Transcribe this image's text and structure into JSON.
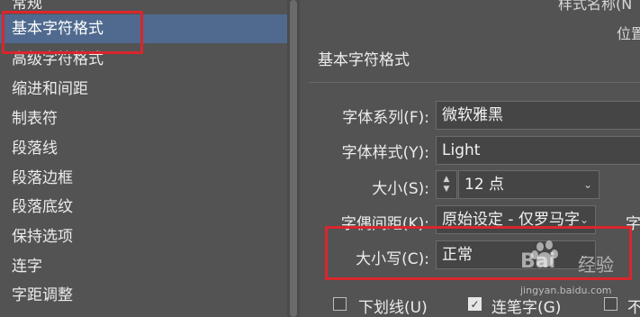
{
  "sidebar": {
    "items": [
      {
        "label": "常规"
      },
      {
        "label": "基本字符格式"
      },
      {
        "label": "高级字符格式"
      },
      {
        "label": "缩进和间距"
      },
      {
        "label": "制表符"
      },
      {
        "label": "段落线"
      },
      {
        "label": "段落边框"
      },
      {
        "label": "段落底纹"
      },
      {
        "label": "保持选项"
      },
      {
        "label": "连字"
      },
      {
        "label": "字距调整"
      }
    ],
    "selected_index": 1
  },
  "header": {
    "style_name_label": "样式名称(N",
    "position_label": "位置"
  },
  "section": {
    "title": "基本字符格式"
  },
  "form": {
    "font_family": {
      "label": "字体系列(F):",
      "value": "微软雅黑"
    },
    "font_style": {
      "label": "字体样式(Y):",
      "value": "Light"
    },
    "size": {
      "label": "大小(S):",
      "value": "12 点"
    },
    "tracking": {
      "label": "字偶间距(K):",
      "value": "原始设定 - 仅罗马字",
      "right_label": "字"
    },
    "case": {
      "label": "大小写(C):",
      "value": "正常"
    }
  },
  "checkboxes": [
    {
      "label": "下划线(U)",
      "checked": false
    },
    {
      "label": "连笔字(G)",
      "checked": true
    },
    {
      "label": "不",
      "checked": false
    }
  ],
  "watermark": {
    "brand": "Bai",
    "brand2": "经验",
    "url": "jingyan.baidu.com"
  },
  "colors": {
    "selection": "#4f6a8e",
    "highlight_box": "#d9262c",
    "background": "#535353"
  }
}
